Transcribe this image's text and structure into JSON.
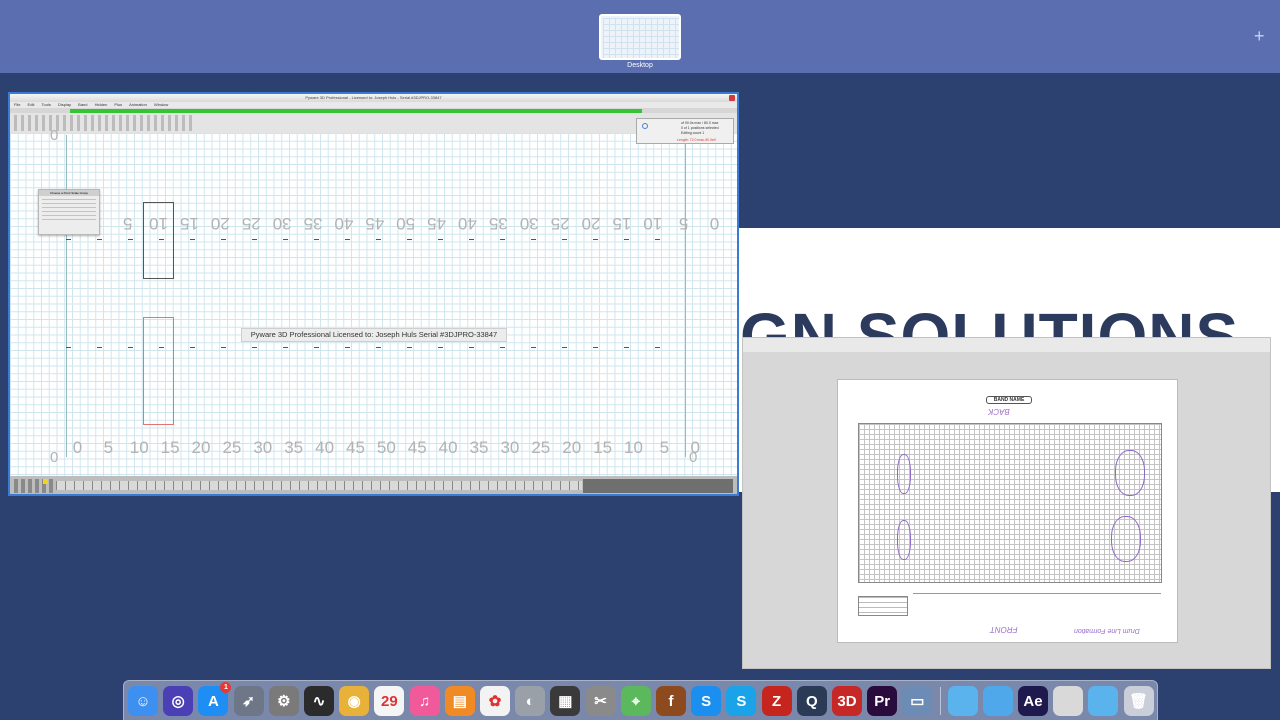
{
  "mission_control": {
    "space_label": "Desktop",
    "add_space_symbol": "+"
  },
  "background": {
    "headline": "GN SOLUTIONS"
  },
  "pyware": {
    "title": "Pyware 3D Professional - Licensed to: Joseph Huls - Serial #3DJPRO-33847",
    "menu": "File Edit Tools Display Band Hidden Plus Animation Window",
    "license_text": "Pyware 3D Professional   Licensed to: Joseph Huls   Serial #3DJPRO-33847",
    "zero_label": "0",
    "yard_top": [
      "0",
      "5",
      "10",
      "15",
      "20",
      "25",
      "30",
      "35",
      "40",
      "45",
      "50",
      "45",
      "40",
      "35",
      "30",
      "25",
      "20",
      "15",
      "10",
      "5"
    ],
    "yard_bottom": [
      "0",
      "5",
      "10",
      "15",
      "20",
      "25",
      "30",
      "35",
      "40",
      "45",
      "50",
      "45",
      "40",
      "35",
      "30",
      "25",
      "20",
      "15",
      "10",
      "5",
      "0"
    ],
    "dialog_title": "Choose a Point Scale Group",
    "minipanel": {
      "line1": "of 90.0s max / 80.0 max",
      "line2": "0 of 1 positions selected",
      "line3": "Editing count 1",
      "warning": "Length: 72.0 max-90.0e0"
    }
  },
  "preview": {
    "page_header": "BAND NAME",
    "back_label": "BACK",
    "front_label": "FRONT",
    "signature": "Drum Line Formation"
  },
  "dock": {
    "items": [
      {
        "name": "finder-icon",
        "label": "Finder",
        "color": "#3d8ff0",
        "glyph": "☺"
      },
      {
        "name": "siri-icon",
        "label": "Siri",
        "color": "#4a3fb5",
        "glyph": "◎"
      },
      {
        "name": "app-store-icon",
        "label": "App Store",
        "color": "#1e8ef5",
        "glyph": "A",
        "badge": "1"
      },
      {
        "name": "launchpad-icon",
        "label": "Launchpad",
        "color": "#6e7787",
        "glyph": "➶"
      },
      {
        "name": "system-preferences-icon",
        "label": "System Preferences",
        "color": "#7a7a7a",
        "glyph": "⚙"
      },
      {
        "name": "activity-monitor-icon",
        "label": "Activity Monitor",
        "color": "#2b2b2b",
        "glyph": "∿"
      },
      {
        "name": "chrome-icon",
        "label": "Google Chrome",
        "color": "#e8b13a",
        "glyph": "◉"
      },
      {
        "name": "calendar-icon",
        "label": "Calendar",
        "color": "#f5f5f5",
        "glyph": "29"
      },
      {
        "name": "itunes-icon",
        "label": "iTunes",
        "color": "#f05a9a",
        "glyph": "♫"
      },
      {
        "name": "ibooks-icon",
        "label": "iBooks",
        "color": "#f08a24",
        "glyph": "▤"
      },
      {
        "name": "photos-icon",
        "label": "Photos",
        "color": "#f3f3f3",
        "glyph": "✿"
      },
      {
        "name": "disk-utility-icon",
        "label": "Disk Utility",
        "color": "#9aa0a8",
        "glyph": "◐"
      },
      {
        "name": "claquette-icon",
        "label": "Claquette",
        "color": "#3a3a3a",
        "glyph": "▦"
      },
      {
        "name": "scissors-icon",
        "label": "Utility",
        "color": "#8a8a8a",
        "glyph": "✂"
      },
      {
        "name": "maps-icon",
        "label": "Maps",
        "color": "#5cb85c",
        "glyph": "⌖"
      },
      {
        "name": "font-icon",
        "label": "Font Book",
        "color": "#8d4a1f",
        "glyph": "f"
      },
      {
        "name": "shazam-icon",
        "label": "Shazam",
        "color": "#1a8ff0",
        "glyph": "S"
      },
      {
        "name": "skype-icon",
        "label": "Skype",
        "color": "#1aa3e8",
        "glyph": "S"
      },
      {
        "name": "filezilla-icon",
        "label": "FileZilla",
        "color": "#c6251d",
        "glyph": "Z"
      },
      {
        "name": "quicktime-icon",
        "label": "QuickTime",
        "color": "#2b3a55",
        "glyph": "Q"
      },
      {
        "name": "pyware-icon",
        "label": "Pyware 3D",
        "color": "#c62828",
        "glyph": "3D"
      },
      {
        "name": "premiere-icon",
        "label": "Premiere Pro",
        "color": "#2a0b3d",
        "glyph": "Pr"
      },
      {
        "name": "preview-icon",
        "label": "Preview",
        "color": "#6c8bb5",
        "glyph": "▭"
      },
      {
        "name": "folder-icon",
        "label": "Folder",
        "color": "#5ab3ec",
        "glyph": ""
      },
      {
        "name": "folder-icon",
        "label": "Folder",
        "color": "#4fa8ea",
        "glyph": ""
      },
      {
        "name": "after-effects-icon",
        "label": "After Effects",
        "color": "#1f1a4d",
        "glyph": "Ae"
      },
      {
        "name": "document-icon",
        "label": "Document",
        "color": "#d9d9d9",
        "glyph": ""
      },
      {
        "name": "folder-icon",
        "label": "Folder",
        "color": "#5ab3ec",
        "glyph": ""
      },
      {
        "name": "trash-icon",
        "label": "Trash",
        "color": "#c9ced8",
        "glyph": "🗑"
      }
    ]
  }
}
